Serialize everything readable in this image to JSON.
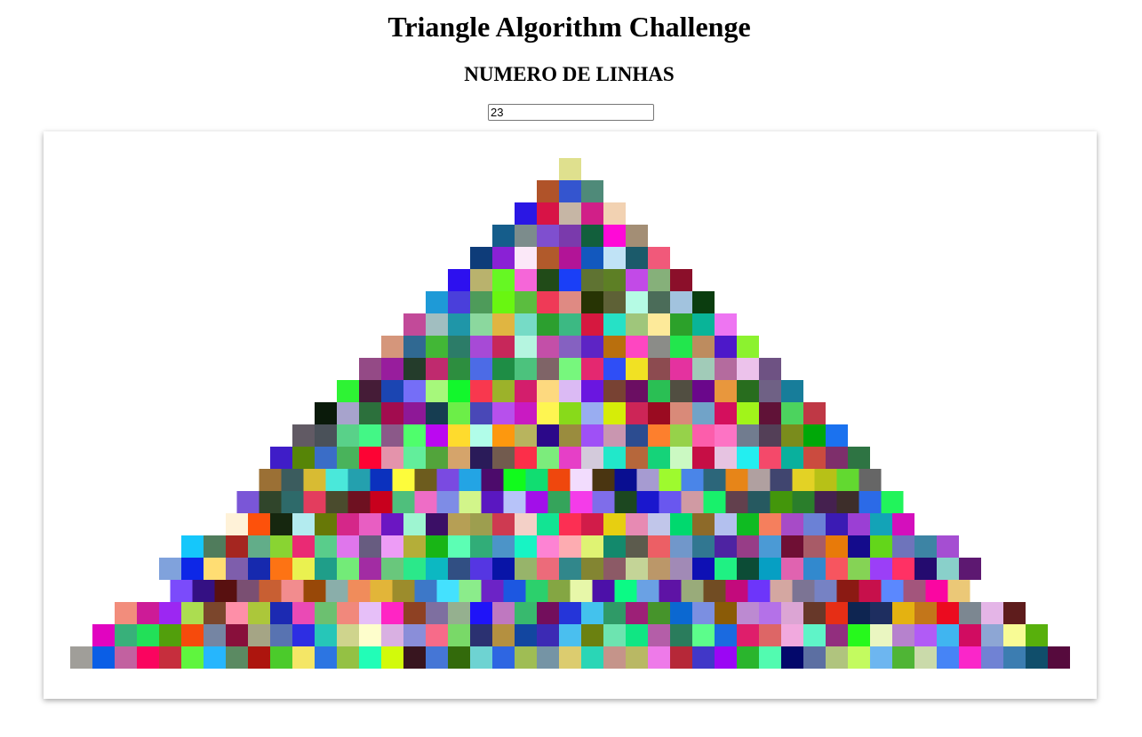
{
  "header": {
    "title": "Triangle Algorithm Challenge",
    "rows_label": "NUMERO DE LINHAS"
  },
  "rows_input": {
    "value": "23"
  },
  "triangle": {
    "row_count": 23,
    "background": "#ffffff",
    "rows": [
      [
        "#dfe08e"
      ],
      [
        "#b05329",
        "#3455cf",
        "#4f8a79"
      ],
      [
        "#2a17e4",
        "#d81346",
        "#c6b6a5",
        "#d11f88",
        "#f2d2b2"
      ],
      [
        "#155d8b",
        "#7c8c8c",
        "#7f4fcf",
        "#7a3aac",
        "#125f3c",
        "#ff09d7",
        "#a38e75"
      ],
      [
        "#0e3c79",
        "#8a21d5",
        "#fbe8f8",
        "#b15a2b",
        "#b21497",
        "#1258be",
        "#c0e3f6",
        "#1b5a6a",
        "#f1597a"
      ],
      [
        "#2d10ef",
        "#b9b26d",
        "#66f723",
        "#f566d8",
        "#214b18",
        "#1a3ff7",
        "#5f7332",
        "#5d7f25",
        "#c24ae7",
        "#86b07a",
        "#8b0f2a"
      ],
      [
        "#1e9ad7",
        "#4a3fdb",
        "#4e9b5a",
        "#69f611",
        "#5bbd3f",
        "#ef3a57",
        "#df8a83",
        "#273404",
        "#5e6136",
        "#b5fbe4",
        "#4b6c59",
        "#a2c3de",
        "#0b3d0f"
      ],
      [
        "#c24a99",
        "#a1bec0",
        "#1f96a8",
        "#8bd89e",
        "#e0b541",
        "#76dbc6",
        "#2c9f2f",
        "#3cb983",
        "#d6183f",
        "#26e1c6",
        "#9fc67b",
        "#fdea9a",
        "#2ca12a",
        "#09b498",
        "#ee75f2"
      ],
      [
        "#d5967b",
        "#306992",
        "#42b736",
        "#2c7c68",
        "#a74ad6",
        "#c7275a",
        "#b5f5e0",
        "#c34fa8",
        "#8561c1",
        "#5d24c5",
        "#b96f0d",
        "#fe46c1",
        "#8b8c88",
        "#22e64d",
        "#bd8c5f",
        "#4d18c9",
        "#8cf22f"
      ],
      [
        "#944a86",
        "#981d9d",
        "#243c2b",
        "#bf2a6e",
        "#2d8e3f",
        "#4c6be6",
        "#1e8d45",
        "#4cc27d",
        "#7f6467",
        "#77f77d",
        "#e42870",
        "#2f4ef6",
        "#f1e123",
        "#8c4b50",
        "#e4329f",
        "#a1cbb8",
        "#b46b9e",
        "#ecc2eb",
        "#6e5283"
      ],
      [
        "#2ef334",
        "#451c37",
        "#1b45b2",
        "#756ef7",
        "#a6f87b",
        "#12f72c",
        "#f8384e",
        "#9cb22a",
        "#d31e6c",
        "#fdd97f",
        "#dbbaf4",
        "#6a16e0",
        "#784233",
        "#6b0e62",
        "#2abf54",
        "#514e41",
        "#6a078b",
        "#e8973d",
        "#286d1e",
        "#6f6185",
        "#177d9a"
      ],
      [
        "#0a1a0a",
        "#a7a3cc",
        "#2c703c",
        "#a20c4f",
        "#8e1897",
        "#163d51",
        "#6cee48",
        "#4948b7",
        "#b750ec",
        "#c91ac2",
        "#fef551",
        "#88da1a",
        "#99adf1",
        "#d6ed08",
        "#cd2557",
        "#9a0b21",
        "#d98a79",
        "#71a3c8",
        "#d40f5d",
        "#a1f41a",
        "#601237",
        "#4cd35e",
        "#bf3845"
      ],
      [
        "#615a64",
        "#4a5159",
        "#59d189",
        "#43f786",
        "#8b5989",
        "#4ffe6c",
        "#bb08f1",
        "#fedb2d",
        "#b1fde9",
        "#fd980e",
        "#b8b45e",
        "#2b0889",
        "#9a8c3e",
        "#9f50f6",
        "#c996b0",
        "#2c4c90",
        "#fd7f2d",
        "#96d24a",
        "#fc5dab",
        "#fd73c4",
        "#717c8f",
        "#533f57",
        "#7a8c1c",
        "#00a808",
        "#1b72ef"
      ],
      [
        "#3f1dc8",
        "#568507",
        "#3a6dc7",
        "#49b35b",
        "#fd0334",
        "#e493ab",
        "#62ee9b",
        "#52a43b",
        "#d5a46b",
        "#2a1b59",
        "#725b4e",
        "#fc2e49",
        "#7cec7c",
        "#e63fc7",
        "#d3cadb",
        "#21e8ca",
        "#b6673b",
        "#15d379",
        "#cbf9c2",
        "#c60e45",
        "#e6c3e1",
        "#23eef0",
        "#f4496a",
        "#09b09d",
        "#cb4b3f",
        "#7e2f6b",
        "#2e7443"
      ],
      [
        "#9b7035",
        "#3b5c5e",
        "#d8bb33",
        "#4ae8da",
        "#24a0ae",
        "#0b31be",
        "#fdfc3b",
        "#6d5c1e",
        "#7a4ae1",
        "#23a4e4",
        "#4c0b6b",
        "#11fb1c",
        "#11dd71",
        "#ef470d",
        "#f2dcfd",
        "#4a3511",
        "#090e91",
        "#a69bd1",
        "#9efa2e",
        "#4a85e8",
        "#2c667a",
        "#e78518",
        "#b0a0a0",
        "#40456f",
        "#e3d225",
        "#b7c117",
        "#62d930",
        "#666666"
      ],
      [
        "#7a56d7",
        "#30452b",
        "#2e6a6a",
        "#e33d5e",
        "#4a4b2d",
        "#6e1121",
        "#c8001d",
        "#4fbf7c",
        "#ee6dc6",
        "#7e8ce6",
        "#d2f58a",
        "#5a17c1",
        "#b7c3f9",
        "#a20fe9",
        "#35a45b",
        "#f43ce9",
        "#7f6dea",
        "#1c4720",
        "#1a17cd",
        "#6957ef",
        "#d09aa3",
        "#18f16b",
        "#62404d",
        "#265960",
        "#43960b",
        "#2a7e2b",
        "#45214f",
        "#3d2e2a",
        "#2b6ae7",
        "#21f45b"
      ],
      [
        "#fff2d8",
        "#fd510b",
        "#16270f",
        "#b3ebef",
        "#677807",
        "#d52789",
        "#e85ec2",
        "#6b16c2",
        "#9ef5d1",
        "#3b0f66",
        "#b69f55",
        "#9d9e4f",
        "#ce3a51",
        "#f3d0c7",
        "#12e493",
        "#fc2f53",
        "#d11c49",
        "#e7cf11",
        "#e78ab3",
        "#c1c6ea",
        "#00d96e",
        "#8d6a29",
        "#b3c0ee",
        "#0fbb22",
        "#f57f5d",
        "#a74bc7",
        "#6b81d6",
        "#3b1bb4",
        "#9b3fd4",
        "#13a3b7",
        "#d40fbc"
      ],
      [
        "#15c7fb",
        "#507c5c",
        "#a52620",
        "#62ad89",
        "#89d432",
        "#ea2a74",
        "#59cd8b",
        "#df76ec",
        "#675c80",
        "#ed9cf6",
        "#b4ae39",
        "#18b515",
        "#5cfeb4",
        "#31ad78",
        "#4c94c8",
        "#17f4c4",
        "#fd83d3",
        "#fdacb1",
        "#dff373",
        "#13896c",
        "#5c5b4d",
        "#ec5f65",
        "#7197ca",
        "#317791",
        "#4e23a2",
        "#973d87",
        "#4b9ad5",
        "#6f0f34",
        "#a85b67",
        "#e87a09",
        "#140b8c",
        "#63d61a",
        "#6e74bb",
        "#3d84a4",
        "#a54ed2"
      ],
      [
        "#80a2dc",
        "#0d27e7",
        "#ffdd73",
        "#7e5eac",
        "#1629ae",
        "#fd7314",
        "#eaf150",
        "#1f9e89",
        "#73eb78",
        "#a22ca3",
        "#69c77c",
        "#2be88a",
        "#0cb8c2",
        "#314f83",
        "#5536e2",
        "#0814a7",
        "#97b46a",
        "#ec6b7a",
        "#31878b",
        "#838532",
        "#8c5a66",
        "#c4d497",
        "#bb9769",
        "#a18ab6",
        "#0e10b4",
        "#1ff183",
        "#0c4c36",
        "#069fc3",
        "#e063b0",
        "#3289ce",
        "#f7555f",
        "#85d355",
        "#9b3ff7",
        "#ff3164",
        "#240b6f",
        "#89d0ca",
        "#5d1871"
      ],
      [
        "#7b4bfb",
        "#341083",
        "#581010",
        "#7a4f72",
        "#c85f33",
        "#f28c8e",
        "#984808",
        "#8aaeaa",
        "#f08c5b",
        "#e2b539",
        "#9c8c2c",
        "#3d78c8",
        "#44e1fe",
        "#8bec8b",
        "#6c23c6",
        "#1c57e1",
        "#2cd06c",
        "#84a643",
        "#e7f7a9",
        "#4c10a8",
        "#0bfa85",
        "#6aa1e4",
        "#5e13a5",
        "#99ab7a",
        "#714c23",
        "#c30a7c",
        "#6d35fa",
        "#d4a7a1",
        "#7c7494",
        "#7682c4",
        "#8b1a13",
        "#c7104b",
        "#5b88fe",
        "#a3557c",
        "#fa06a1",
        "#ebc877"
      ],
      [
        "#f28d7c",
        "#cd1b97",
        "#9c27f2",
        "#acdd50",
        "#7b462c",
        "#fe8fa8",
        "#acc73a",
        "#1c2ab2",
        "#ea4ab5",
        "#6cc070",
        "#f1887c",
        "#e6bff8",
        "#ff25c4",
        "#8e4123",
        "#7e6fa0",
        "#95b08f",
        "#1f14f8",
        "#bf78c0",
        "#38b96e",
        "#730e5c",
        "#2535d9",
        "#43c2ed",
        "#2f9a67",
        "#9d2077",
        "#46942b",
        "#0b68d1",
        "#7b8fe1",
        "#8a5b07",
        "#bc8ad1",
        "#b471e8",
        "#dca5d4",
        "#673829",
        "#e62e15",
        "#0e2551",
        "#1e2e60",
        "#e4b211",
        "#c3761a",
        "#eb0b1f",
        "#7c8791",
        "#e4b5e7",
        "#5e1c1c"
      ],
      [
        "#e104c0",
        "#38b07a",
        "#22e058",
        "#529f0c",
        "#f64a0c",
        "#7585a3",
        "#880f3b",
        "#a5a585",
        "#5873b1",
        "#2d2ee3",
        "#26c6b8",
        "#cfd48d",
        "#fefecc",
        "#d9b0e2",
        "#8a8ed9",
        "#f76b89",
        "#79d968",
        "#2b3171",
        "#b49040",
        "#1246a0",
        "#3c2ab4",
        "#4abfef",
        "#6b8110",
        "#6de4b0",
        "#10e683",
        "#b45ea8",
        "#2a7c5c",
        "#5cfd8b",
        "#1a6ae0",
        "#df1e6b",
        "#dd6666",
        "#f1a9de",
        "#5ff4c8",
        "#922e7e",
        "#26f91c",
        "#eaf6c1",
        "#b682cd",
        "#b15bf6",
        "#40b5f0",
        "#d10c61",
        "#8da6d4",
        "#f8fb95",
        "#58b00c"
      ],
      [
        "#a09e99",
        "#0a5ee6",
        "#c261a0",
        "#fa045f",
        "#c62e3d",
        "#5ff53e",
        "#26b6fd",
        "#5b8a62",
        "#ad150e",
        "#4bcb2b",
        "#f4e666",
        "#2c75e2",
        "#94c144",
        "#22fdb7",
        "#d2fa0b",
        "#38151f",
        "#4576d6",
        "#336a0b",
        "#6ed3d2",
        "#2e66e2",
        "#9fbd54",
        "#7594a5",
        "#dccc6f",
        "#2ad6b6",
        "#c5948a",
        "#b9b864",
        "#ee7ae9",
        "#b62838",
        "#4137c8",
        "#9b06f4",
        "#2ab52d",
        "#52fbb0",
        "#03086b",
        "#5c6fa2",
        "#b0c47e",
        "#c3fb5f",
        "#6db6f0",
        "#4fb535",
        "#cadaaa",
        "#4684f6",
        "#fa26c9",
        "#7082d4",
        "#3c7db1",
        "#104e6b",
        "#560a3d"
      ]
    ]
  }
}
